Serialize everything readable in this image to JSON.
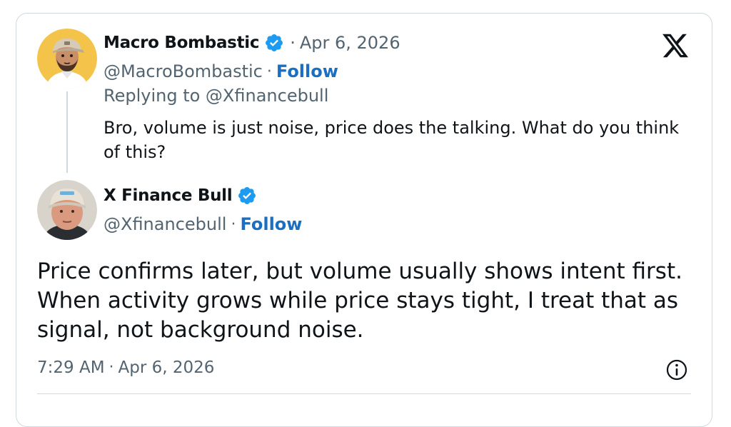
{
  "reply": {
    "display_name": "Macro Bombastic",
    "date": "Apr 6, 2026",
    "handle": "@MacroBombastic",
    "follow_label": "Follow",
    "replying_to": "Replying to @Xfinancebull",
    "text": "Bro, volume is just noise, price does the talking. What do you think of this?"
  },
  "tweet": {
    "display_name": "X Finance Bull",
    "handle": "@Xfinancebull",
    "follow_label": "Follow",
    "text": "Price confirms later, but volume usually shows intent first. When activity grows while price stays tight, I treat that as signal, not background noise.",
    "time": "7:29 AM",
    "date": "Apr 6, 2026"
  },
  "separator": "·",
  "icons": {
    "logo": "x-logo-icon",
    "verified": "verified-badge-icon",
    "info": "info-icon"
  },
  "colors": {
    "verified_blue": "#1d9bf0",
    "follow_blue": "#1b6fc2",
    "secondary_text": "#536471",
    "border": "#cfd9de"
  }
}
